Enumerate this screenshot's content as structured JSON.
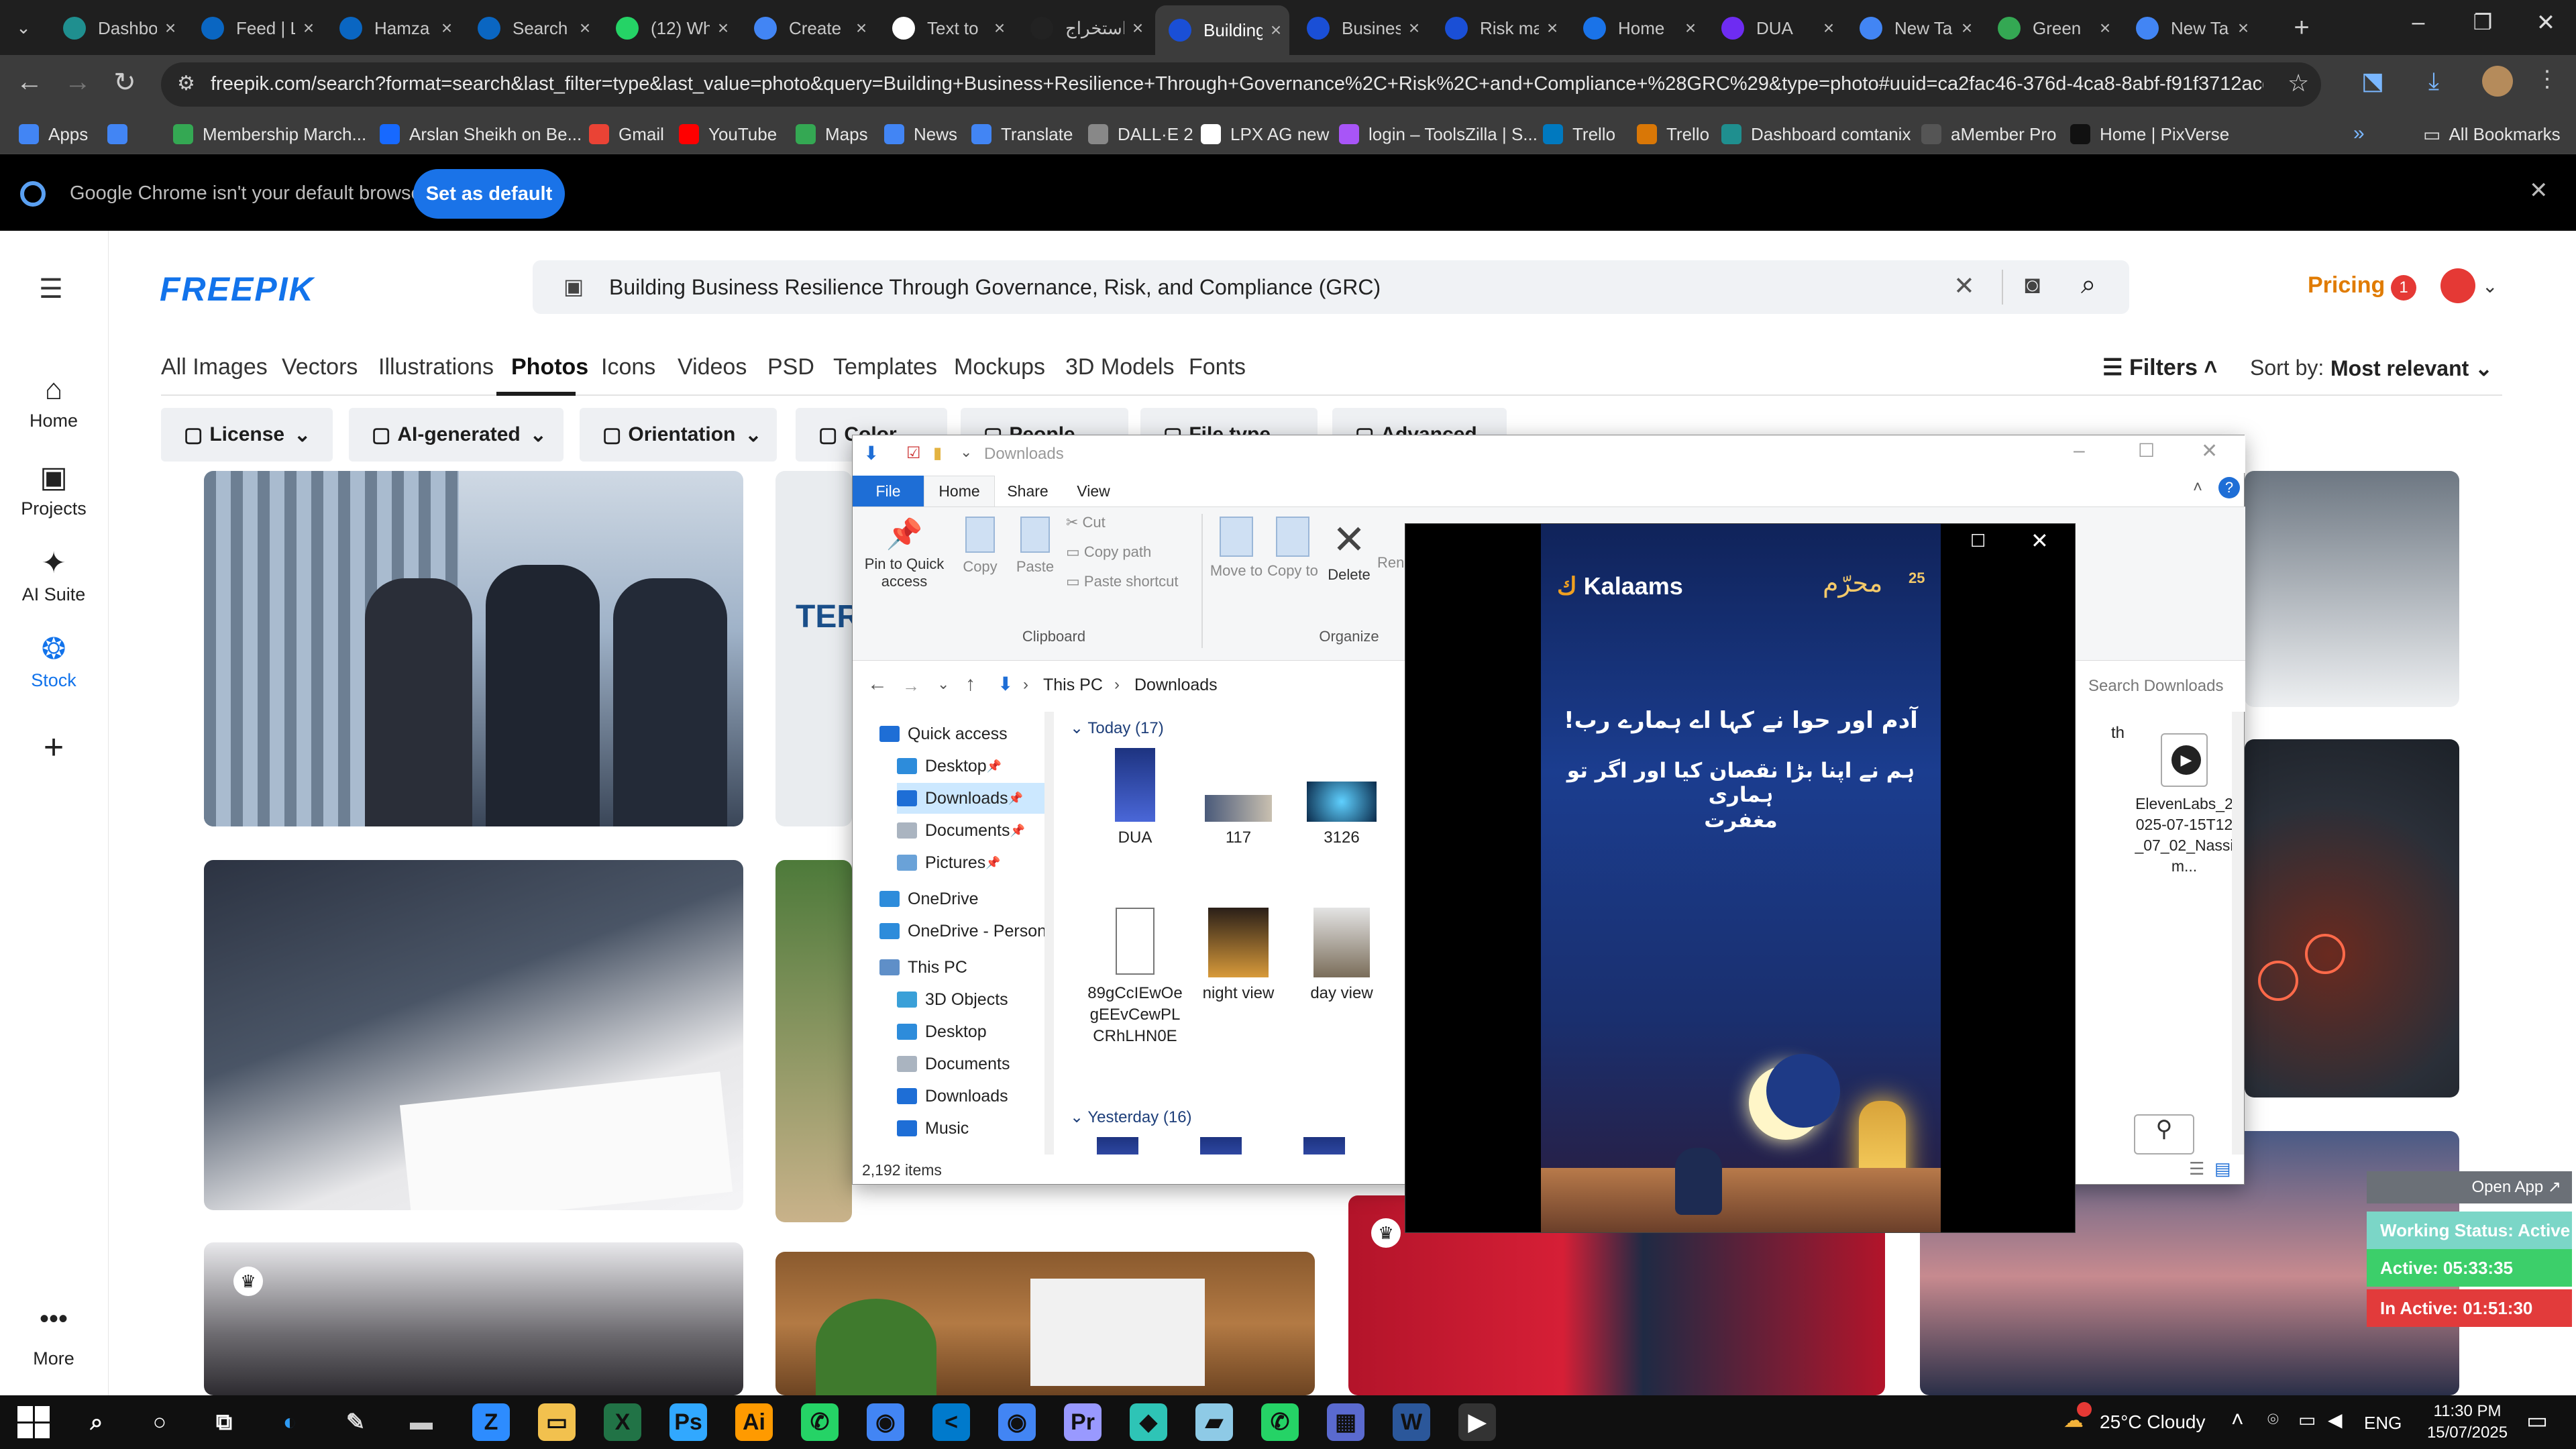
{
  "browser": {
    "tabs": [
      {
        "label": "Dashboard",
        "color": "#1f8f8f"
      },
      {
        "label": "Feed | LinkedIn",
        "color": "#0a66c2"
      },
      {
        "label": "Hamza",
        "color": "#0a66c2"
      },
      {
        "label": "Search",
        "color": "#0a66c2"
      },
      {
        "label": "(12) WhatsApp",
        "color": "#25d366"
      },
      {
        "label": "Create",
        "color": "#4285f4"
      },
      {
        "label": "Text to",
        "color": "#ffffff"
      },
      {
        "label": "استخراج",
        "color": "#222222"
      },
      {
        "label": "Building",
        "color": "#1a4fd6"
      },
      {
        "label": "Business",
        "color": "#1a4fd6"
      },
      {
        "label": "Risk management",
        "color": "#1a4fd6"
      },
      {
        "label": "Home",
        "color": "#1a73e8"
      },
      {
        "label": "DUA",
        "color": "#6e2cf2"
      },
      {
        "label": "New Tab",
        "color": "#4285f4"
      },
      {
        "label": "Green",
        "color": "#34a853"
      },
      {
        "label": "New Tab",
        "color": "#4285f4"
      }
    ],
    "active_tab": 8,
    "new_tab_symbol": "+",
    "url": "freepik.com/search?format=search&last_filter=type&last_value=photo&query=Building+Business+Resilience+Through+Governance%2C+Risk%2C+and+Compliance+%28GRC%29&type=photo#uuid=ca2fac46-376d-4ca8-8abf-f91f3712acd7",
    "bookmarks": [
      {
        "label": "Apps",
        "color": "#4285f4"
      },
      {
        "label": "",
        "color": "#4285f4"
      },
      {
        "label": "Membership March...",
        "color": "#34a853"
      },
      {
        "label": "Arslan Sheikh on Be...",
        "color": "#1769ff"
      },
      {
        "label": "Gmail",
        "color": "#ea4335"
      },
      {
        "label": "YouTube",
        "color": "#ff0000"
      },
      {
        "label": "Maps",
        "color": "#34a853"
      },
      {
        "label": "News",
        "color": "#4285f4"
      },
      {
        "label": "Translate",
        "color": "#4285f4"
      },
      {
        "label": "DALL·E 2",
        "color": "#888888"
      },
      {
        "label": "LPX AG new",
        "color": "#ffffff"
      },
      {
        "label": "login – ToolsZilla | S...",
        "color": "#a855f7"
      },
      {
        "label": "Trello",
        "color": "#0079bf"
      },
      {
        "label": "Trello",
        "color": "#d97706"
      },
      {
        "label": "Dashboard comtanix",
        "color": "#1f8f8f"
      },
      {
        "label": "aMember Pro",
        "color": "#555555"
      },
      {
        "label": "Home | PixVerse",
        "color": "#111111"
      }
    ],
    "all_bookmarks": "All Bookmarks",
    "overflow": "»",
    "infobar": {
      "text": "Google Chrome isn't your default browser",
      "button": "Set as default"
    }
  },
  "freepik": {
    "logo": "FREEPIK",
    "search_value": "Building Business Resilience Through Governance, Risk, and Compliance (GRC)",
    "pricing": "Pricing",
    "notifications": "1",
    "sidebar": [
      "Home",
      "Projects",
      "AI Suite",
      "Stock"
    ],
    "more": "More",
    "categories": [
      "All Images",
      "Vectors",
      "Illustrations",
      "Photos",
      "Icons",
      "Videos",
      "PSD",
      "Templates",
      "Mockups",
      "3D Models",
      "Fonts"
    ],
    "active_category": "Photos",
    "filters_label": "Filters",
    "sort_label": "Sort by:",
    "sort_value": "Most relevant",
    "filter_chips": [
      "License",
      "AI-generated",
      "Orientation",
      "Color",
      "People",
      "File type",
      "Advanced"
    ]
  },
  "explorer": {
    "title": "Downloads",
    "ribbon_tabs": [
      "File",
      "Home",
      "Share",
      "View"
    ],
    "clipboard": [
      "Pin to Quick access",
      "Copy",
      "Paste",
      "Cut",
      "Copy path",
      "Paste shortcut"
    ],
    "clipboard_group": "Clipboard",
    "organize": [
      "Move to",
      "Copy to",
      "Delete",
      "Rename"
    ],
    "organize_group": "Organize",
    "breadcrumb": [
      "This PC",
      "Downloads"
    ],
    "search_placeholder": "Search Downloads",
    "nav": [
      "Quick access",
      "Desktop",
      "Downloads",
      "Documents",
      "Pictures",
      "OneDrive",
      "OneDrive - Person",
      "This PC",
      "3D Objects",
      "Desktop",
      "Documents",
      "Downloads",
      "Music"
    ],
    "groups": [
      "Today (17)",
      "Yesterday (16)"
    ],
    "files": [
      "DUA",
      "117",
      "3126",
      "89gCcIEwOegEEvCewPLCRhLHN0E",
      "night view",
      "day view"
    ],
    "right_files": [
      "th",
      "ElevenLabs_2025-07-15T12_07_02_Nassim..."
    ],
    "status": "2,192 items"
  },
  "video": {
    "brand": "Kalaams",
    "badge": "25",
    "badge_text": "محرّم",
    "urdu_lines": [
      "آدم اور حوا نے کہا اے ہمارے رب!",
      "ہم نے اپنا بڑا نقصان کیا اور اگر تو ہماری",
      "مغفرت"
    ]
  },
  "tracker": {
    "open_app": "Open App ↗",
    "status": "Working Status: Active",
    "active": "Active: 05:33:35",
    "inactive": "In Active: 01:51:30"
  },
  "taskbar": {
    "weather": "25°C  Cloudy",
    "lang": "ENG",
    "time": "11:30 PM",
    "date": "15/07/2025",
    "apps": [
      {
        "glyph": "Z",
        "color": "#2d8cff"
      },
      {
        "glyph": "▭",
        "color": "#f2c14e"
      },
      {
        "glyph": "X",
        "color": "#217346"
      },
      {
        "glyph": "Ps",
        "color": "#31a8ff"
      },
      {
        "glyph": "Ai",
        "color": "#ff9a00"
      },
      {
        "glyph": "✆",
        "color": "#25d366"
      },
      {
        "glyph": "◉",
        "color": "#4285f4"
      },
      {
        "glyph": "<",
        "color": "#007acc"
      },
      {
        "glyph": "◉",
        "color": "#4285f4"
      },
      {
        "glyph": "Pr",
        "color": "#9999ff"
      },
      {
        "glyph": "◆",
        "color": "#2ec4b6"
      },
      {
        "glyph": "▰",
        "color": "#8ecae6"
      },
      {
        "glyph": "✆",
        "color": "#25d366"
      },
      {
        "glyph": "▦",
        "color": "#5a6acf"
      },
      {
        "glyph": "W",
        "color": "#2b579a"
      },
      {
        "glyph": "▶",
        "color": "#ffffff"
      }
    ]
  }
}
